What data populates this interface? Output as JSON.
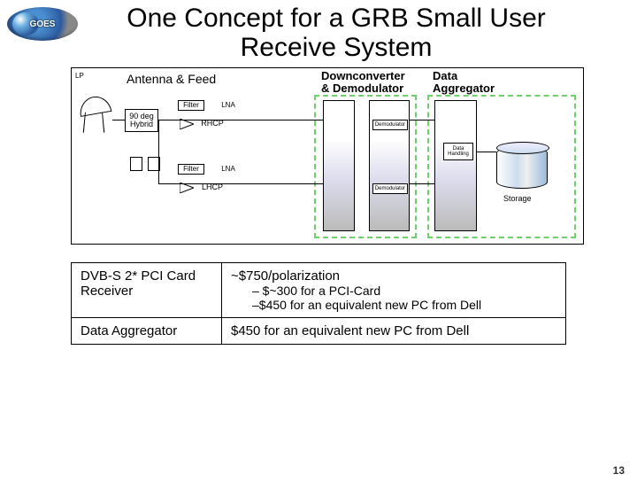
{
  "logo_text": "GOES",
  "title": "One Concept for a GRB Small User Receive System",
  "sections": {
    "antenna": "Antenna & Feed",
    "lp": "LP",
    "downconverter": "Downconverter\n& Demodulator",
    "aggregator": "Data\nAggregator"
  },
  "blocks": {
    "hybrid": "90 deg Hybrid",
    "filter": "Filter",
    "lna": "LNA",
    "rhcp": "RHCP",
    "lhcp": "LHCP",
    "demod": "Demodulator",
    "data_handling": "Data Handling",
    "storage": "Storage"
  },
  "table": {
    "r1c1": "DVB-S 2* PCI Card Receiver",
    "r1_head": "~$750/polarization",
    "r1_sub1": "– $~300 for a PCI-Card",
    "r1_sub2": "–$450 for an equivalent new PC from Dell",
    "r2c1": "Data Aggregator",
    "r2c2": "$450 for an equivalent new PC from Dell"
  },
  "page_number": "13"
}
